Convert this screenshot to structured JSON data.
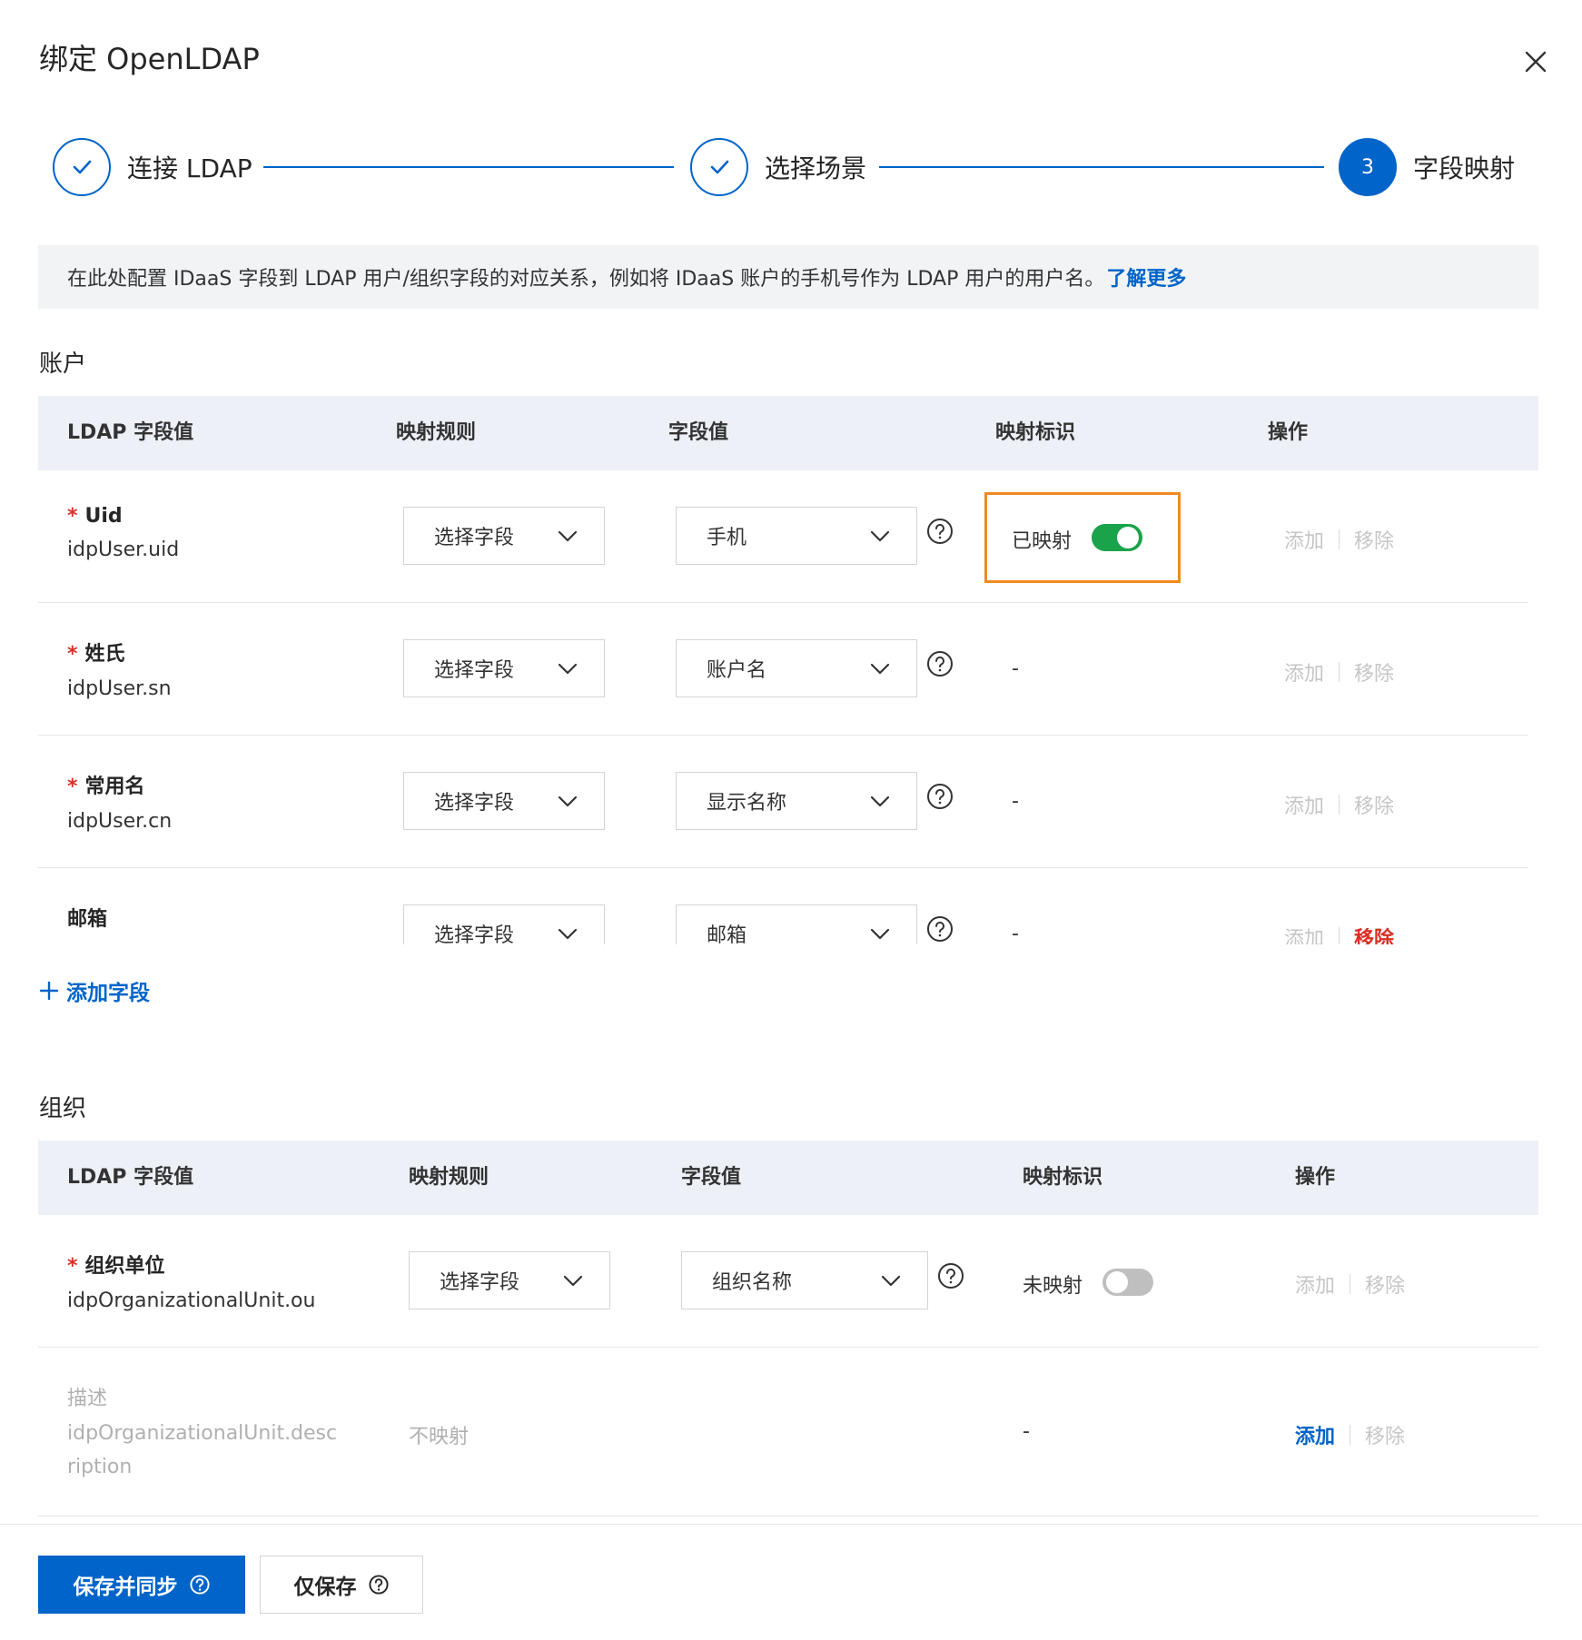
{
  "dialog": {
    "title": "绑定 OpenLDAP"
  },
  "steps": [
    {
      "label": "连接 LDAP",
      "status": "done"
    },
    {
      "label": "选择场景",
      "status": "done"
    },
    {
      "label": "字段映射",
      "status": "active",
      "number": "3"
    }
  ],
  "notice": {
    "text": "在此处配置 IDaaS 字段到 LDAP 用户/组织字段的对应关系，例如将 IDaaS 账户的手机号作为 LDAP 用户的用户名。",
    "link": "了解更多"
  },
  "columns": {
    "account": [
      "LDAP 字段值",
      "映射规则",
      "字段值",
      "映射标识",
      "操作"
    ],
    "org": [
      "LDAP 字段值",
      "映射规则",
      "字段值",
      "映射标识",
      "操作"
    ]
  },
  "account": {
    "title": "账户",
    "rows": [
      {
        "name": "Uid",
        "key": "idpUser.uid",
        "required": true,
        "rule": "选择字段",
        "value": "手机",
        "flag": "已映射",
        "add": "添加",
        "remove": "移除"
      },
      {
        "name": "姓氏",
        "key": "idpUser.sn",
        "required": true,
        "rule": "选择字段",
        "value": "账户名",
        "flag": "-",
        "add": "添加",
        "remove": "移除"
      },
      {
        "name": "常用名",
        "key": "idpUser.cn",
        "required": true,
        "rule": "选择字段",
        "value": "显示名称",
        "flag": "-",
        "add": "添加",
        "remove": "移除"
      },
      {
        "name": "邮箱",
        "key": "",
        "required": false,
        "rule": "选择字段",
        "value": "邮箱",
        "flag": "-",
        "add": "添加",
        "remove": "移除"
      }
    ],
    "add_field": "添加字段"
  },
  "org": {
    "title": "组织",
    "rows": [
      {
        "name": "组织单位",
        "key": "idpOrganizationalUnit.ou",
        "required": true,
        "rule": "选择字段",
        "value": "组织名称",
        "flag": "未映射",
        "add": "添加",
        "remove": "移除"
      },
      {
        "name": "描述",
        "key_line1": "idpOrganizationalUnit.desc",
        "key_line2": "ription",
        "rule": "不映射",
        "flag": "-",
        "add": "添加",
        "remove": "移除"
      }
    ]
  },
  "footer": {
    "save_sync": "保存并同步",
    "save_only": "仅保存"
  },
  "colors": {
    "primary": "#0064c8",
    "toggle_on": "#1aa34a",
    "highlight": "#f08a24",
    "danger": "#d93026"
  }
}
